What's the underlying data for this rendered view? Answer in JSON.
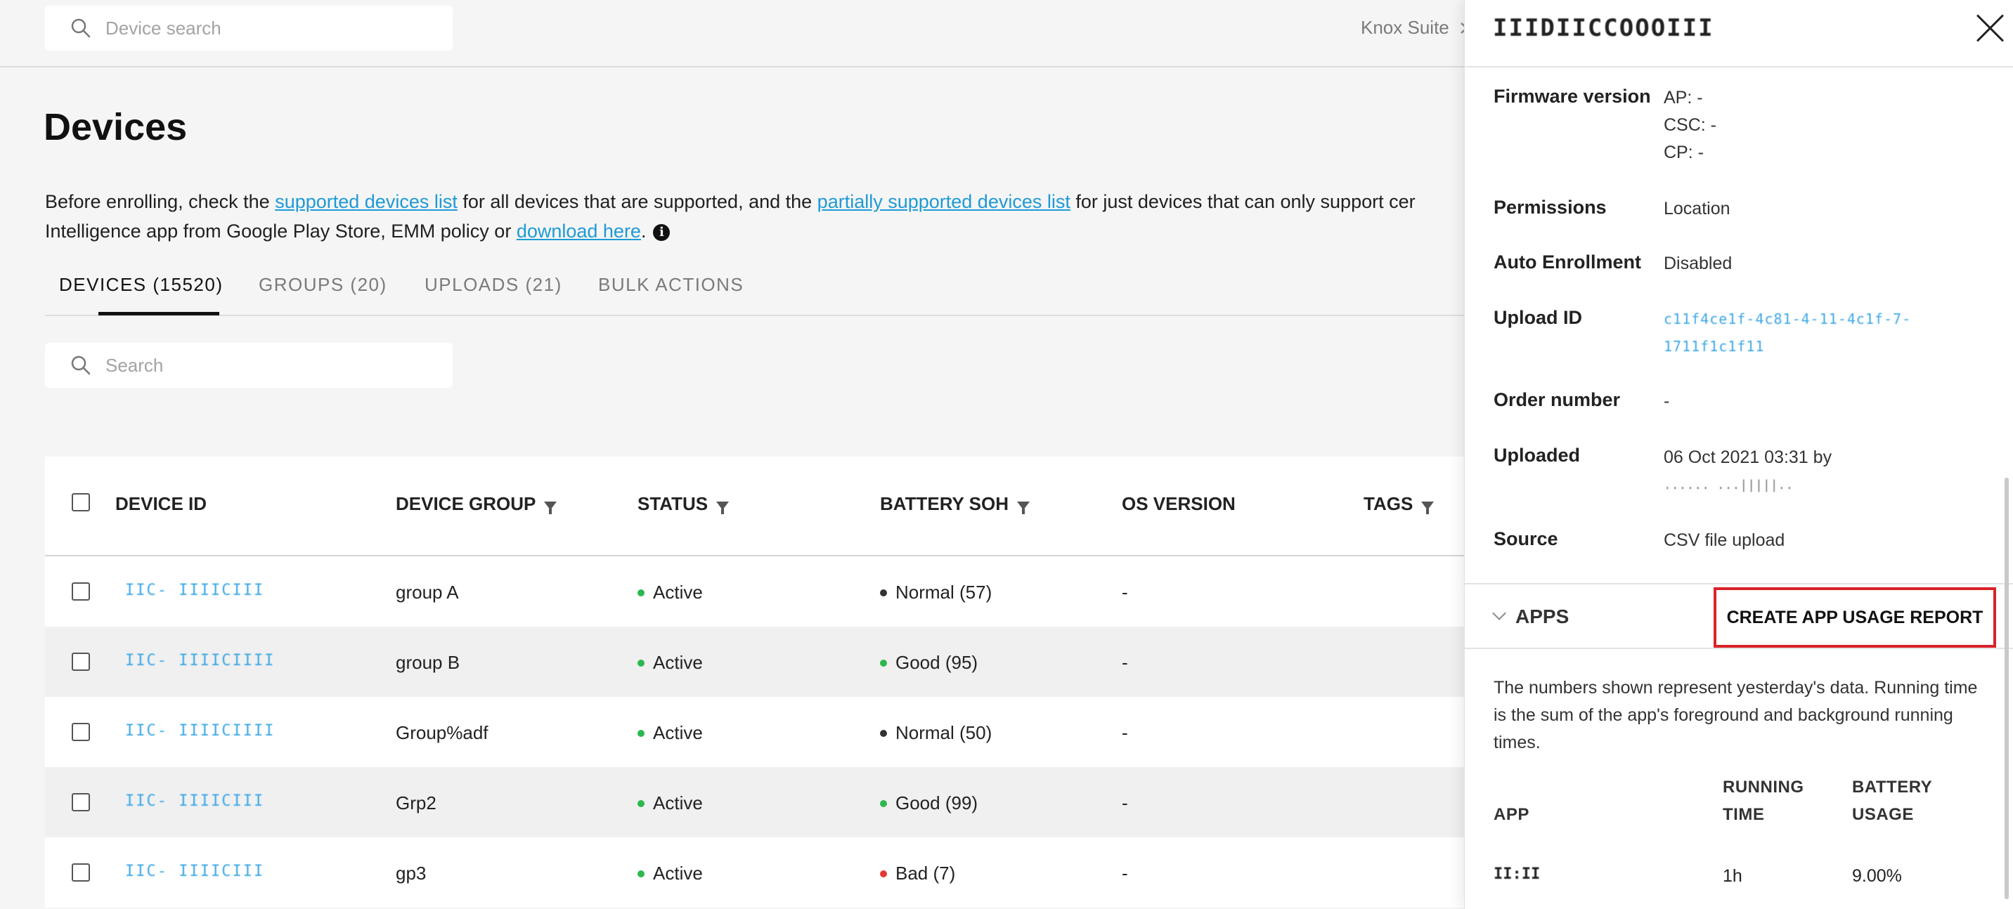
{
  "topbar": {
    "search_placeholder": "Device search",
    "breadcrumb": "Knox Suite",
    "breadcrumb_icon": "chevron-right-icon"
  },
  "page": {
    "title": "Devices",
    "intro": {
      "t1": "Before enrolling, check the ",
      "link1": "supported devices list",
      "t2": " for all devices that are supported, and the ",
      "link2": "partially supported devices list",
      "t3": " for just devices that can only support cer",
      "t4": "Intelligence app from Google Play Store, EMM policy or ",
      "link3": "download here",
      "t5": ".",
      "info_icon": "i"
    }
  },
  "tabs": [
    {
      "label": "DEVICES (15520)",
      "active": true
    },
    {
      "label": "GROUPS (20)",
      "active": false
    },
    {
      "label": "UPLOADS (21)",
      "active": false
    },
    {
      "label": "BULK ACTIONS",
      "active": false
    }
  ],
  "table_search": {
    "placeholder": "Search"
  },
  "table": {
    "headers": [
      "DEVICE ID",
      "DEVICE GROUP",
      "STATUS",
      "BATTERY SOH",
      "OS VERSION",
      "TAGS"
    ],
    "rows": [
      {
        "device_id": "IIC- IIIICIII",
        "group": "group A",
        "status": "Active",
        "battery": "Normal (57)",
        "battery_color": "#333333",
        "os": "-"
      },
      {
        "device_id": "IIC- IIIICIIII",
        "group": "group B",
        "status": "Active",
        "battery": "Good (95)",
        "battery_color": "#2db84d",
        "os": "-"
      },
      {
        "device_id": "IIC- IIIICIIII",
        "group": "Group%adf",
        "status": "Active",
        "battery": "Normal (50)",
        "battery_color": "#333333",
        "os": "-"
      },
      {
        "device_id": "IIC- IIIICIII",
        "group": "Grp2",
        "status": "Active",
        "battery": "Good (99)",
        "battery_color": "#2db84d",
        "os": "-"
      },
      {
        "device_id": "IIC- IIIICIII",
        "group": "gp3",
        "status": "Active",
        "battery": "Bad (7)",
        "battery_color": "#e53935",
        "os": "-"
      }
    ],
    "status_color": "#2db84d"
  },
  "panel": {
    "device_name": "IIIDIICCOOOIII",
    "close_icon": "close-icon",
    "fields": {
      "firmware_label": "Firmware version",
      "firmware_ap": "AP: -",
      "firmware_csc": "CSC: -",
      "firmware_cp": "CP: -",
      "permissions_label": "Permissions",
      "permissions_value": "Location",
      "auto_label": "Auto Enrollment",
      "auto_value": "Disabled",
      "upload_label": "Upload ID",
      "upload_value_1": "c11f4ce1f-4c81-4-11-4c1f-7-",
      "upload_value_2": "1711f1c1f11",
      "order_label": "Order number",
      "order_value": "-",
      "uploaded_label": "Uploaded",
      "uploaded_value": "06 Oct 2021 03:31 by",
      "uploaded_by": "...... ...|||||..",
      "source_label": "Source",
      "source_value": "CSV file upload"
    },
    "apps": {
      "title": "APPS",
      "report_button": "CREATE APP USAGE REPORT",
      "note": "The numbers shown represent yesterday's data. Running time is the sum of the app's foreground and background running times.",
      "col_app": "APP",
      "col_running_1": "RUNNING",
      "col_running_2": "TIME",
      "col_battery_1": "BATTERY",
      "col_battery_2": "USAGE",
      "rows": [
        {
          "app": "II:II",
          "running": "1h",
          "battery": "9.00%"
        }
      ]
    }
  },
  "colors": {
    "accent_link": "#1e9ad6",
    "highlight_border": "#d9232a"
  }
}
